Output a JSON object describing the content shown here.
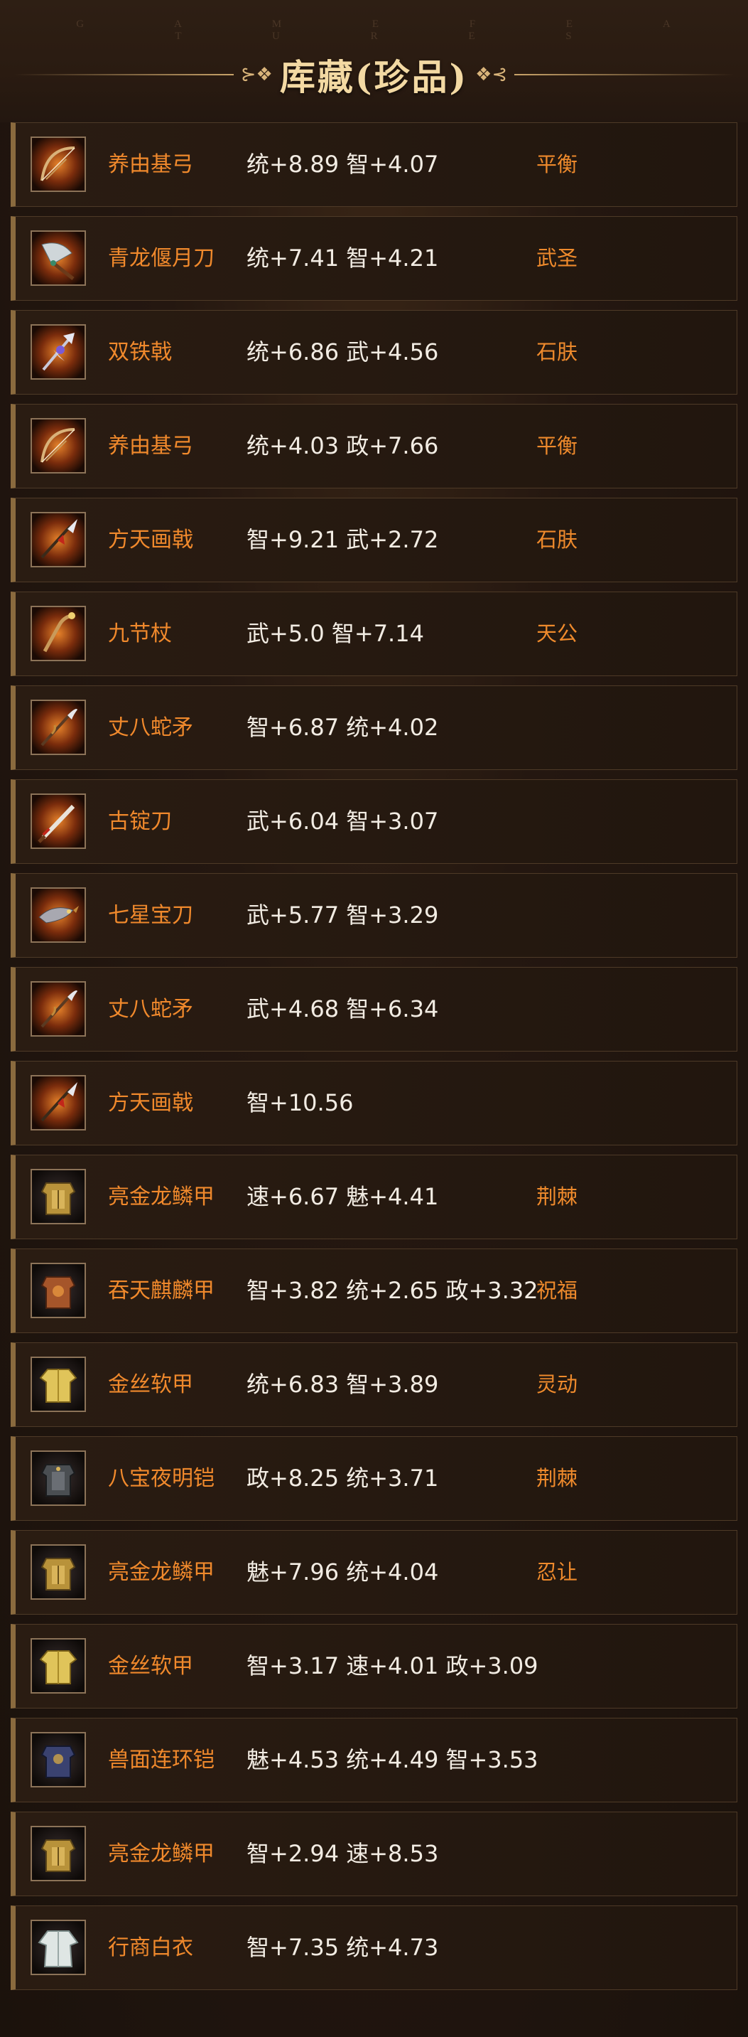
{
  "header": {
    "watermark": "G A M E   F E A T U R E S",
    "title": "库藏(珍品)",
    "ornament_left": "⊱❖",
    "ornament_right": "❖⊰"
  },
  "items": [
    {
      "icon": "bow-icon",
      "name": "养由基弓",
      "stats": "统+8.89 智+4.07",
      "trait": "平衡"
    },
    {
      "icon": "blade-icon",
      "name": "青龙偃月刀",
      "stats": "统+7.41 智+4.21",
      "trait": "武圣"
    },
    {
      "icon": "halberd-icon",
      "name": "双铁戟",
      "stats": "统+6.86 武+4.56",
      "trait": "石肤"
    },
    {
      "icon": "bow-icon",
      "name": "养由基弓",
      "stats": "统+4.03 政+7.66",
      "trait": "平衡"
    },
    {
      "icon": "spear-icon",
      "name": "方天画戟",
      "stats": "智+9.21 武+2.72",
      "trait": "石肤"
    },
    {
      "icon": "staff-icon",
      "name": "九节杖",
      "stats": "武+5.0 智+7.14",
      "trait": "天公"
    },
    {
      "icon": "snake-spear-icon",
      "name": "丈八蛇矛",
      "stats": "智+6.87 统+4.02",
      "trait": ""
    },
    {
      "icon": "sword-icon",
      "name": "古锭刀",
      "stats": "武+6.04 智+3.07",
      "trait": ""
    },
    {
      "icon": "dragon-blade-icon",
      "name": "七星宝刀",
      "stats": "武+5.77 智+3.29",
      "trait": ""
    },
    {
      "icon": "snake-spear-icon",
      "name": "丈八蛇矛",
      "stats": "武+4.68 智+6.34",
      "trait": ""
    },
    {
      "icon": "spear-icon",
      "name": "方天画戟",
      "stats": "智+10.56",
      "trait": ""
    },
    {
      "icon": "gold-armor-icon",
      "name": "亮金龙鳞甲",
      "stats": "速+6.67 魅+4.41",
      "trait": "荆棘"
    },
    {
      "icon": "bronze-armor-icon",
      "name": "吞天麒麟甲",
      "stats": "智+3.82 统+2.65 政+3.32",
      "trait": "祝福"
    },
    {
      "icon": "robe-icon",
      "name": "金丝软甲",
      "stats": "统+6.83 智+3.89",
      "trait": "灵动"
    },
    {
      "icon": "dark-armor-icon",
      "name": "八宝夜明铠",
      "stats": "政+8.25 统+3.71",
      "trait": "荆棘"
    },
    {
      "icon": "gold-armor-icon",
      "name": "亮金龙鳞甲",
      "stats": "魅+7.96 统+4.04",
      "trait": "忍让"
    },
    {
      "icon": "robe-icon",
      "name": "金丝软甲",
      "stats": "智+3.17 速+4.01 政+3.09",
      "trait": ""
    },
    {
      "icon": "beast-armor-icon",
      "name": "兽面连环铠",
      "stats": "魅+4.53 统+4.49 智+3.53",
      "trait": ""
    },
    {
      "icon": "gold-armor-icon",
      "name": "亮金龙鳞甲",
      "stats": "智+2.94 速+8.53",
      "trait": ""
    },
    {
      "icon": "white-robe-icon",
      "name": "行商白衣",
      "stats": "智+7.35 统+4.73",
      "trait": ""
    }
  ],
  "colors": {
    "name": "#f0892c",
    "stats": "#f2ece3",
    "trait": "#ee8a2c",
    "title": "#f3d9a3"
  }
}
